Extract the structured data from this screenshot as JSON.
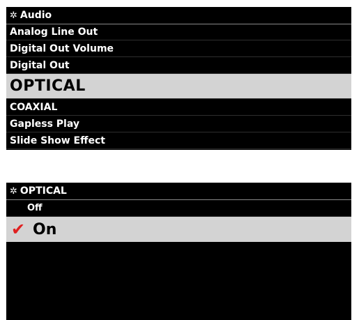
{
  "colors": {
    "screen_bg": "#000000",
    "highlight_bg": "#d3d3d3",
    "checkmark": "#e02020",
    "text": "#ffffff"
  },
  "audio_menu": {
    "icon": "gear-icon",
    "title": "Audio",
    "items": [
      {
        "label": "Analog Line Out",
        "selected": false
      },
      {
        "label": "Digital Out Volume",
        "selected": false
      },
      {
        "label": "Digital Out",
        "selected": false
      },
      {
        "label": "OPTICAL",
        "selected": true
      },
      {
        "label": "COAXIAL",
        "selected": false
      },
      {
        "label": "Gapless Play",
        "selected": false
      },
      {
        "label": "Slide Show Effect",
        "selected": false
      }
    ]
  },
  "optical_menu": {
    "icon": "gear-icon",
    "title": "OPTICAL",
    "options": [
      {
        "label": "Off",
        "selected": false
      },
      {
        "label": "On",
        "selected": true,
        "check_icon": "checkmark-icon",
        "check_glyph": "✔"
      }
    ]
  }
}
